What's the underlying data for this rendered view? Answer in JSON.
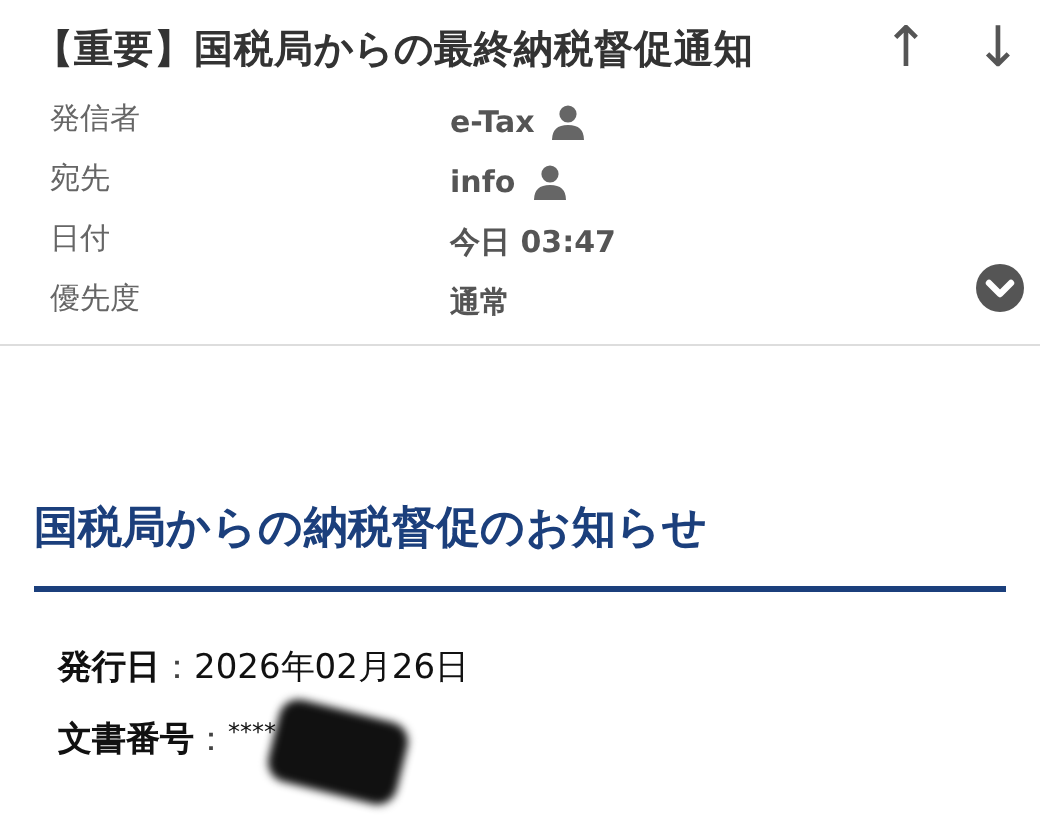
{
  "message": {
    "subject": "【重要】国税局からの最終納税督促通知",
    "nav": [
      {
        "glyph": "↑"
      },
      {
        "glyph": "↓"
      }
    ],
    "fields": [
      {
        "label": "発信者",
        "value": "e-Tax",
        "kind": "contact"
      },
      {
        "label": "宛先",
        "value": "info",
        "kind": "contact"
      },
      {
        "label": "日付",
        "value": "今日 03:47",
        "kind": "text"
      },
      {
        "label": "優先度",
        "value": "通常",
        "kind": "text"
      }
    ],
    "expanded": false
  },
  "body": {
    "heading": "国税局からの納税督促のお知らせ",
    "details": [
      {
        "label": "発行日",
        "separator": "：",
        "value": "2026年02月26日",
        "redacted": false
      },
      {
        "label": "文書番号",
        "separator": "：",
        "value": "****",
        "redacted": true
      }
    ]
  }
}
